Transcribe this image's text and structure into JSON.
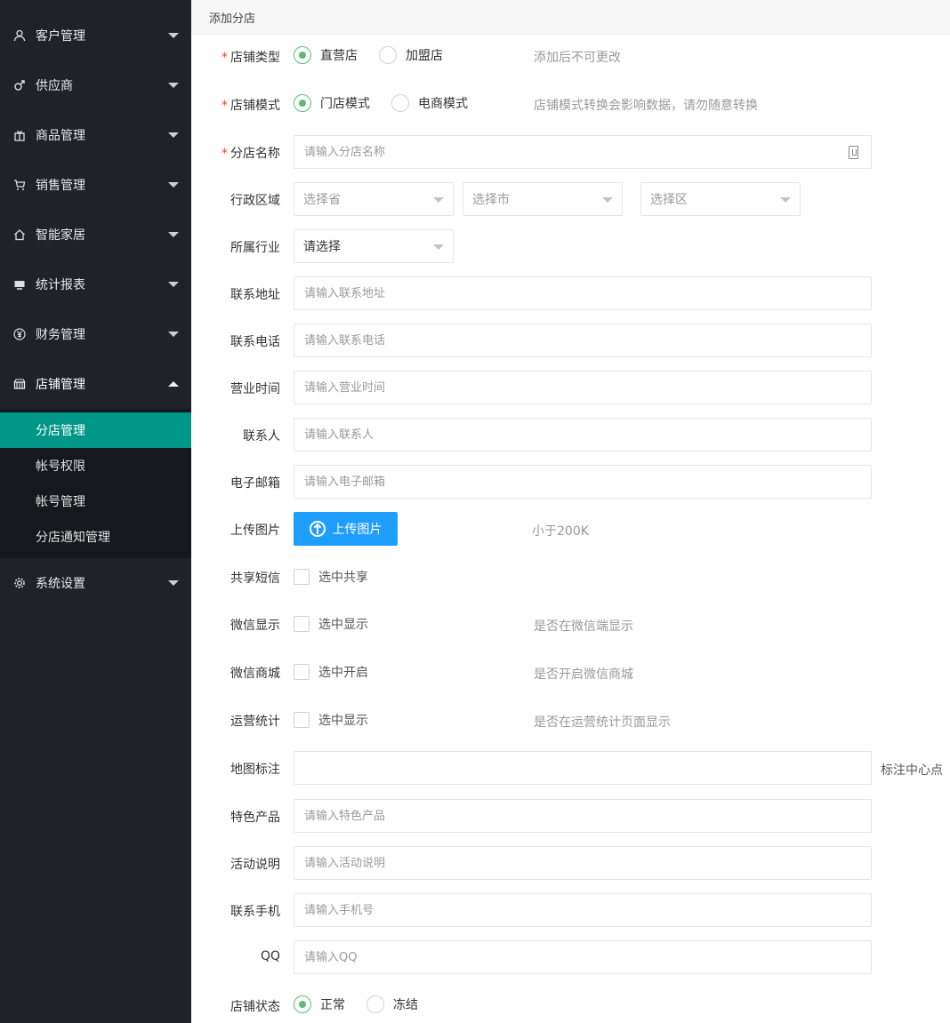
{
  "sidebar": {
    "items": [
      {
        "label": "客户管理",
        "icon": "user-icon"
      },
      {
        "label": "供应商",
        "icon": "male-icon"
      },
      {
        "label": "商品管理",
        "icon": "gift-icon"
      },
      {
        "label": "销售管理",
        "icon": "cart-icon"
      },
      {
        "label": "智能家居",
        "icon": "home-icon"
      },
      {
        "label": "统计报表",
        "icon": "report-icon"
      },
      {
        "label": "财务管理",
        "icon": "yen-icon"
      },
      {
        "label": "店铺管理",
        "icon": "shop-icon"
      },
      {
        "label": "系统设置",
        "icon": "gear-icon"
      }
    ],
    "sub_items": [
      "分店管理",
      "帐号权限",
      "帐号管理",
      "分店通知管理"
    ]
  },
  "header": {
    "title": "添加分店"
  },
  "form": {
    "shop_type": {
      "label": "店铺类型",
      "opt1": "直营店",
      "opt2": "加盟店",
      "hint": "添加后不可更改"
    },
    "shop_mode": {
      "label": "店铺模式",
      "opt1": "门店模式",
      "opt2": "电商模式",
      "hint": "店铺模式转换会影响数据，请勿随意转换"
    },
    "branch_name": {
      "label": "分店名称",
      "placeholder": "请输入分店名称"
    },
    "region": {
      "label": "行政区域",
      "province": "选择省",
      "city": "选择市",
      "district": "选择区"
    },
    "industry": {
      "label": "所属行业",
      "value": "请选择"
    },
    "address": {
      "label": "联系地址",
      "placeholder": "请输入联系地址"
    },
    "phone": {
      "label": "联系电话",
      "placeholder": "请输入联系电话"
    },
    "hours": {
      "label": "营业时间",
      "placeholder": "请输入营业时间"
    },
    "contact": {
      "label": "联系人",
      "placeholder": "请输入联系人"
    },
    "email": {
      "label": "电子邮箱",
      "placeholder": "请输入电子邮箱"
    },
    "upload": {
      "label": "上传图片",
      "button": "上传图片",
      "hint": "小于200K"
    },
    "share_sms": {
      "label": "共享短信",
      "check": "选中共享"
    },
    "wechat_show": {
      "label": "微信显示",
      "check": "选中显示",
      "hint": "是否在微信端显示"
    },
    "wechat_mall": {
      "label": "微信商城",
      "check": "选中开启",
      "hint": "是否开启微信商城"
    },
    "ops_stats": {
      "label": "运营统计",
      "check": "选中显示",
      "hint": "是否在运营统计页面显示"
    },
    "map": {
      "label": "地图标注",
      "note": "标注中心点"
    },
    "product": {
      "label": "特色产品",
      "placeholder": "请输入特色产品"
    },
    "activity": {
      "label": "活动说明",
      "placeholder": "请输入活动说明"
    },
    "mobile": {
      "label": "联系手机",
      "placeholder": "请输入手机号"
    },
    "qq": {
      "label": "QQ",
      "placeholder": "请输入QQ"
    },
    "status": {
      "label": "店铺状态",
      "opt1": "正常",
      "opt2": "冻结"
    }
  },
  "colors": {
    "sidebar_bg": "#20222a",
    "active": "#009688",
    "primary": "#1e9fff",
    "radio": "#5fb878",
    "required": "#ff3b30"
  }
}
